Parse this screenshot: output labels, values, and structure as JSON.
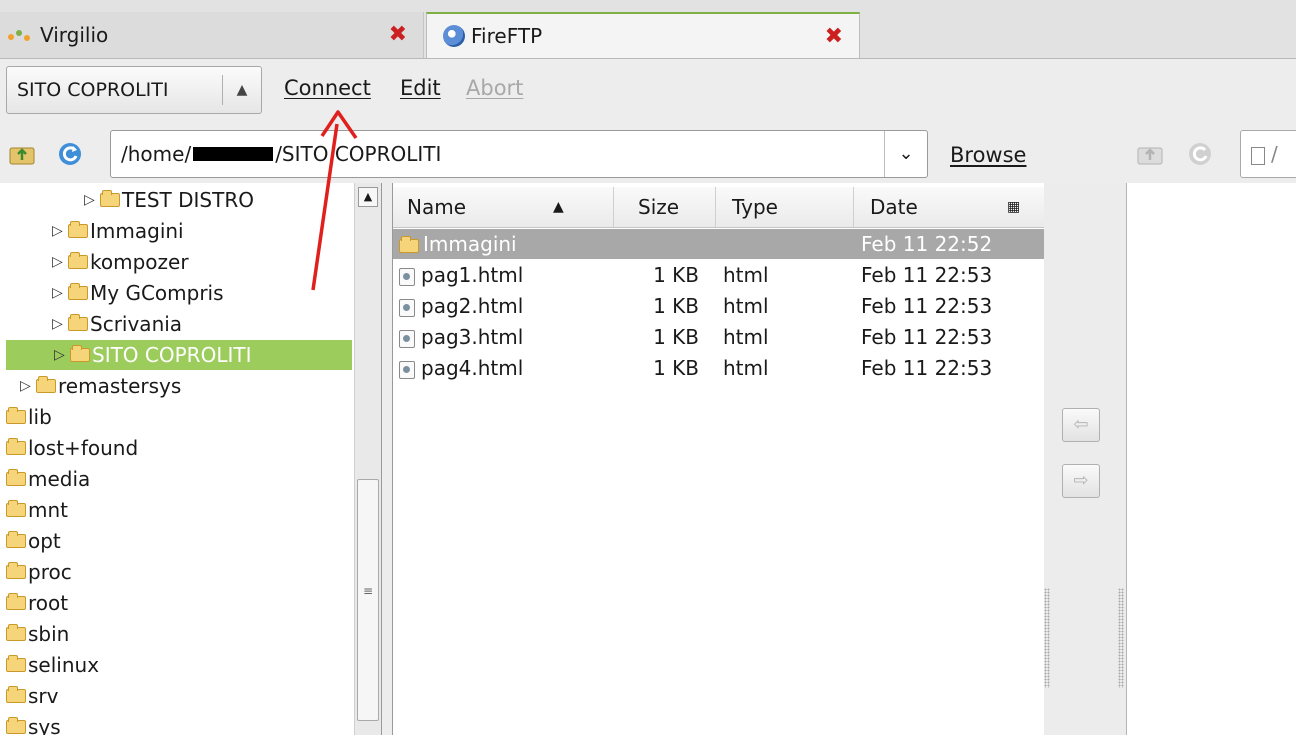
{
  "tabs": [
    {
      "title": "Virgilio",
      "icon": "virgilio-logo-icon",
      "active": false
    },
    {
      "title": "FireFTP",
      "icon": "fireftp-logo-icon",
      "active": true
    }
  ],
  "toolbar": {
    "site": "SITO COPROLITI",
    "connect": "Connect",
    "edit": "Edit",
    "abort": "Abort"
  },
  "local": {
    "path_prefix": "/home/",
    "path_suffix": "/SITO COPROLITI",
    "browse": "Browse"
  },
  "tree": [
    {
      "label": "TEST DISTRO",
      "arrow": "▷",
      "level": 4
    },
    {
      "label": "Immagini",
      "arrow": "▷",
      "level": 3
    },
    {
      "label": "kompozer",
      "arrow": "▷",
      "level": 3
    },
    {
      "label": "My GCompris",
      "arrow": "▷",
      "level": 3
    },
    {
      "label": "Scrivania",
      "arrow": "▷",
      "level": 3
    },
    {
      "label": "SITO COPROLITI",
      "arrow": "▷",
      "level": 3,
      "selected": true
    },
    {
      "label": "remastersys",
      "arrow": "▷",
      "level": 2
    },
    {
      "label": "lib",
      "arrow": "",
      "level": 0
    },
    {
      "label": "lost+found",
      "arrow": "",
      "level": 0
    },
    {
      "label": "media",
      "arrow": "",
      "level": 0
    },
    {
      "label": "mnt",
      "arrow": "",
      "level": 0
    },
    {
      "label": "opt",
      "arrow": "",
      "level": 0
    },
    {
      "label": "proc",
      "arrow": "",
      "level": 0
    },
    {
      "label": "root",
      "arrow": "",
      "level": 0
    },
    {
      "label": "sbin",
      "arrow": "",
      "level": 0
    },
    {
      "label": "selinux",
      "arrow": "",
      "level": 0
    },
    {
      "label": "srv",
      "arrow": "",
      "level": 0
    },
    {
      "label": "sys",
      "arrow": "",
      "level": 0
    }
  ],
  "columns": {
    "name": "Name",
    "size": "Size",
    "type": "Type",
    "date": "Date"
  },
  "files": [
    {
      "name": "Immagini",
      "size": "",
      "type": "",
      "date": "Feb 11 22:52",
      "kind": "folder",
      "selected": true
    },
    {
      "name": "pag1.html",
      "size": "1 KB",
      "type": "html",
      "date": "Feb 11 22:53",
      "kind": "file"
    },
    {
      "name": "pag2.html",
      "size": "1 KB",
      "type": "html",
      "date": "Feb 11 22:53",
      "kind": "file"
    },
    {
      "name": "pag3.html",
      "size": "1 KB",
      "type": "html",
      "date": "Feb 11 22:53",
      "kind": "file"
    },
    {
      "name": "pag4.html",
      "size": "1 KB",
      "type": "html",
      "date": "Feb 11 22:53",
      "kind": "file"
    }
  ],
  "remote": {
    "path": "/"
  },
  "colors": {
    "selection": "#9ccc5c",
    "list_selection": "#a8a8a8",
    "close": "#cc1f1f",
    "annotation": "#e0201c"
  }
}
